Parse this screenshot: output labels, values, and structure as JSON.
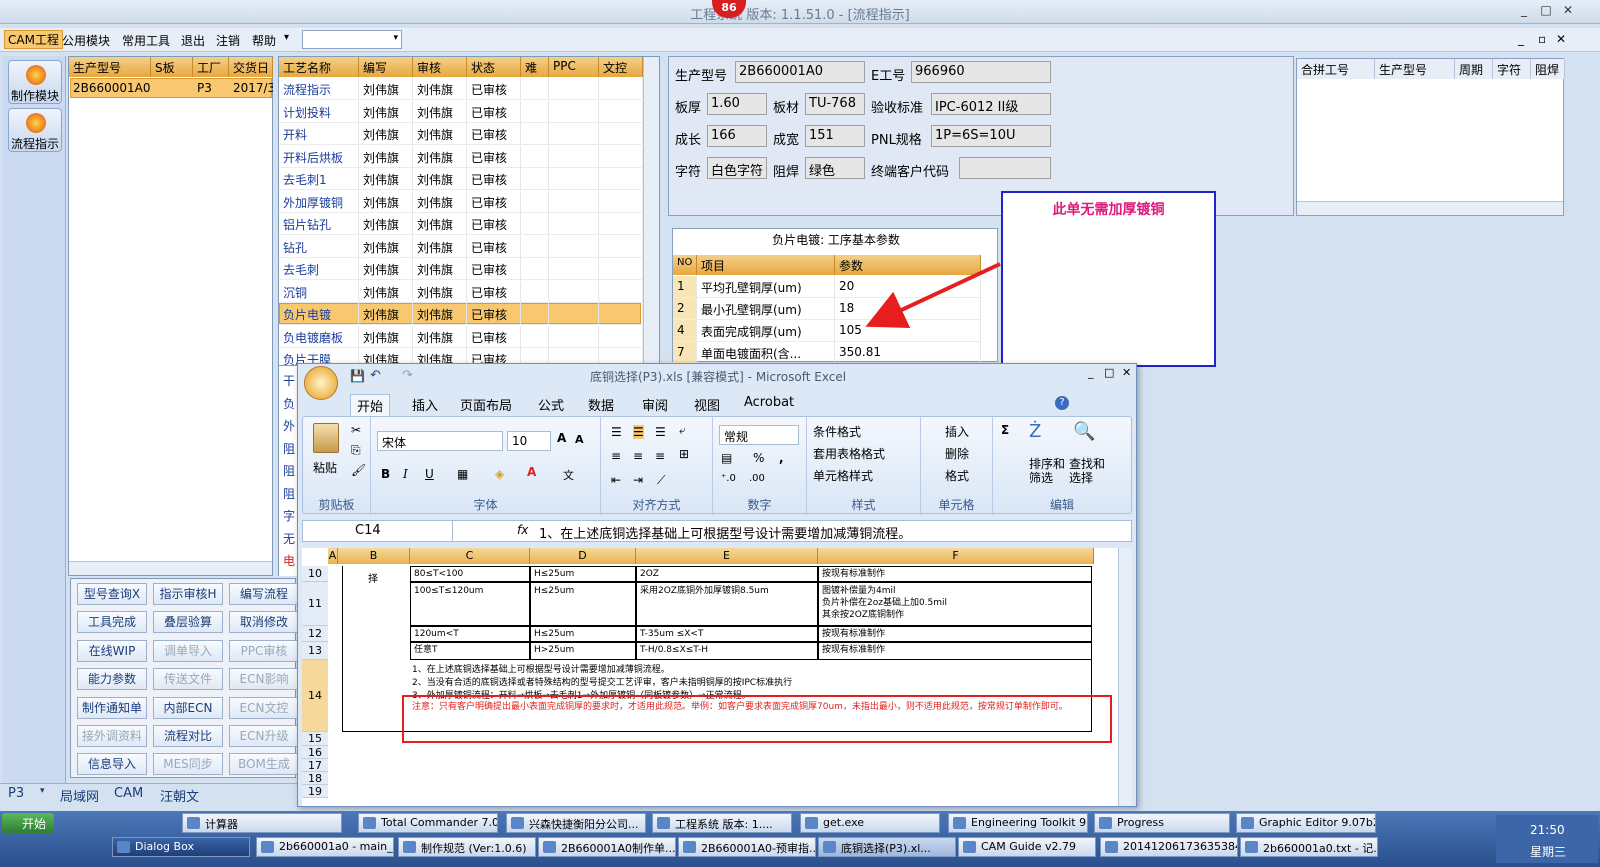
{
  "window": {
    "title": "工程系统  版本: 1.1.51.0 - [流程指示]",
    "notification_count": "86"
  },
  "menu": {
    "items": [
      "CAM工程",
      "公用模块",
      "常用工具",
      "退出",
      "注销",
      "帮助"
    ]
  },
  "sidebar": {
    "buttons": [
      "制作模块",
      "流程指示"
    ]
  },
  "order_grid": {
    "headers": [
      "生产型号",
      "S板",
      "工厂",
      "交货日"
    ],
    "rows": [
      [
        "2B660001A0",
        "",
        "P3",
        "2017/3"
      ]
    ]
  },
  "process_grid": {
    "headers": [
      "工艺名称",
      "编写",
      "审核",
      "状态",
      "难",
      "PPC",
      "文控"
    ],
    "rows": [
      [
        "流程指示",
        "刘伟旗",
        "刘伟旗",
        "已审核"
      ],
      [
        "计划投料",
        "刘伟旗",
        "刘伟旗",
        "已审核"
      ],
      [
        "开料",
        "刘伟旗",
        "刘伟旗",
        "已审核"
      ],
      [
        "开料后烘板",
        "刘伟旗",
        "刘伟旗",
        "已审核"
      ],
      [
        "去毛刺1",
        "刘伟旗",
        "刘伟旗",
        "已审核"
      ],
      [
        "外加厚镀铜",
        "刘伟旗",
        "刘伟旗",
        "已审核"
      ],
      [
        "铝片钻孔",
        "刘伟旗",
        "刘伟旗",
        "已审核"
      ],
      [
        "钻孔",
        "刘伟旗",
        "刘伟旗",
        "已审核"
      ],
      [
        "去毛刺",
        "刘伟旗",
        "刘伟旗",
        "已审核"
      ],
      [
        "沉铜",
        "刘伟旗",
        "刘伟旗",
        "已审核"
      ],
      [
        "负片电镀",
        "刘伟旗",
        "刘伟旗",
        "已审核"
      ],
      [
        "负电镀磨板",
        "刘伟旗",
        "刘伟旗",
        "已审核"
      ],
      [
        "负片干膜",
        "刘伟旗",
        "刘伟旗",
        "已审核"
      ]
    ],
    "selected_index": 10,
    "hidden_prefixes": [
      "干",
      "负",
      "外",
      "阻",
      "阻",
      "阻",
      "字",
      "无",
      "电"
    ]
  },
  "buttons": [
    [
      "型号查询X",
      "指示审核H",
      "编写流程"
    ],
    [
      "工具完成",
      "叠层验算",
      "取消修改"
    ],
    [
      "在线WIP",
      "调单导入",
      "PPC审核"
    ],
    [
      "能力参数",
      "传送文件",
      "ECN影响"
    ],
    [
      "制作通知单",
      "内部ECN",
      "ECN文控"
    ],
    [
      "接外调资料",
      "流程对比",
      "ECN升级"
    ],
    [
      "信息导入",
      "MES同步",
      "BOM生成"
    ]
  ],
  "disabled_buttons": [
    "调单导入",
    "PPC审核",
    "传送文件",
    "ECN影响",
    "ECN文控",
    "接外调资料",
    "ECN升级",
    "MES同步",
    "BOM生成"
  ],
  "status": {
    "plant": "P3",
    "tabs": [
      "局域网",
      "CAM",
      "汪朝文"
    ]
  },
  "info": {
    "model_label": "生产型号",
    "model": "2B660001A0",
    "eno_label": "E工号",
    "eno": "966960",
    "thick_label": "板厚",
    "thick": "1.60",
    "mat_label": "板材",
    "mat": "TU-768",
    "std_label": "验收标准",
    "std": "IPC-6012 II级",
    "len_label": "成长",
    "len": "166",
    "wid_label": "成宽",
    "wid": "151",
    "pnl_label": "PNL规格",
    "pnl": "1P=6S=10U",
    "char_label": "字符",
    "char": "白色字符",
    "mask_label": "阻焊",
    "mask": "绿色",
    "cust_label": "终端客户代码",
    "cust": ""
  },
  "merge_grid": {
    "headers": [
      "合拼工号",
      "生产型号",
      "周期",
      "字符",
      "阻焊"
    ]
  },
  "params": {
    "title": "负片电镀: 工序基本参数",
    "headers": [
      "NO",
      "项目",
      "参数"
    ],
    "rows": [
      [
        "1",
        "平均孔壁铜厚(um)",
        "20"
      ],
      [
        "2",
        "最小孔壁铜厚(um)",
        "18"
      ],
      [
        "4",
        "表面完成铜厚(um)",
        "105"
      ],
      [
        "7",
        "单面电镀面积(含...",
        "350.81"
      ]
    ]
  },
  "note": {
    "text": "此单无需加厚镀铜"
  },
  "excel": {
    "title": "底铜选择(P3).xls [兼容模式] - Microsoft Excel",
    "tabs": [
      "开始",
      "插入",
      "页面布局",
      "公式",
      "数据",
      "审阅",
      "视图",
      "Acrobat"
    ],
    "font_name": "宋体",
    "font_size": "10",
    "number_format": "常规",
    "groups": [
      "剪贴板",
      "字体",
      "对齐方式",
      "数字",
      "样式",
      "单元格",
      "编辑"
    ],
    "paste": "粘贴",
    "style_items": [
      "条件格式",
      "套用表格格式",
      "单元格样式"
    ],
    "cell_items": [
      "插入",
      "删除",
      "格式"
    ],
    "edit_items": [
      "排序和\n筛选",
      "查找和\n选择"
    ],
    "cell_ref": "C14",
    "formula": "1、在上述底铜选择基础上可根据型号设计需要增加减薄铜流程。",
    "columns": [
      "A",
      "B",
      "C",
      "D",
      "E",
      "F"
    ],
    "row_numbers": [
      "10",
      "11",
      "12",
      "13",
      "14",
      "15",
      "16",
      "17",
      "18",
      "19"
    ],
    "rows": [
      [
        "80≤T<100",
        "H≤25um",
        "2OZ",
        "按现有标准制作"
      ],
      [
        "100≤T≤120um",
        "H≤25um",
        "采用2OZ底铜外加厚镀铜8.5um",
        "图镀补偿量为4mil\n负片补偿在2oz基础上加0.5mil\n其余按2OZ底铜制作"
      ],
      [
        "120um<T",
        "H≤25um",
        "T-35um ≤X<T",
        "按现有标准制作"
      ],
      [
        "任意T",
        "H>25um",
        "T-H/0.8≤X≤T-H",
        "按现有标准制作"
      ]
    ],
    "b_label": "择",
    "notes": [
      "1、在上述底铜选择基础上可根据型号设计需要增加减薄铜流程。",
      "2、当没有合适的底铜选择或者特殊结构的型号提交工艺评审，客户未指明铜厚的按IPC标准执行",
      "3、外加厚镀铜流程：开料→烘板→去毛刺1→外加厚镀铜（同板镀参数）→正常流程。"
    ],
    "warning": "注意：只有客户明确提出最小表面完成铜厚的要求时，才适用此规范。举例：如客户要求表面完成铜厚70um，未指出最小，则不适用此规范，按常规订单制作即可。"
  },
  "taskbar": {
    "start": "开始",
    "row1": [
      "计算器",
      "Total Commander 7.0 ...",
      "兴森快捷衡阳分公司...",
      "工程系统  版本: 1....",
      "get.exe",
      "Engineering Toolkit 9....",
      "Progress",
      "Graphic Editor 9.07b2 ..."
    ],
    "row2": [
      "Dialog Box",
      "2b660001a0 - main_ga...",
      "制作规范 (Ver:1.0.6)",
      "2B660001A0制作单...",
      "2B660001A0-预审指...",
      "底铜选择(P3).xl...",
      "CAM Guide v2.79",
      "20141206173635384...",
      "2b660001a0.txt - 记..."
    ],
    "clock": "21:50",
    "day": "星期三"
  },
  "colors": {
    "accent": "#f8c870",
    "red": "#e61e1e",
    "note_border": "#2222cc",
    "note_text": "#e0197c"
  }
}
